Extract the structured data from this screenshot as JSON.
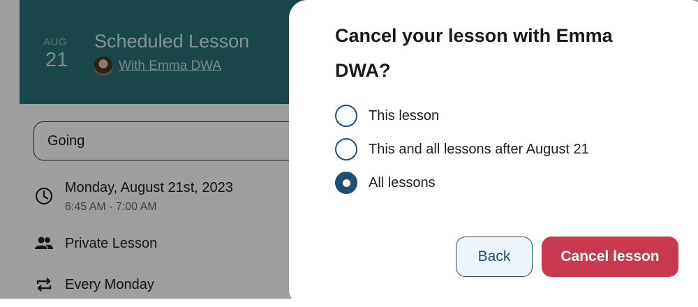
{
  "background": {
    "lesson": {
      "month": "AUG",
      "day": "21",
      "title": "Scheduled Lesson",
      "with_text": "With Emma DWA"
    },
    "rsvp": {
      "value": "Going"
    },
    "details": {
      "date": "Monday, August 21st, 2023",
      "time": "6:45 AM - 7:00 AM",
      "type": "Private Lesson",
      "recurrence": "Every Monday"
    },
    "icons": [
      "clock-icon",
      "people-icon",
      "repeat-icon"
    ]
  },
  "dialog": {
    "title": "Cancel your lesson with Emma DWA?",
    "options": [
      {
        "label": "This lesson",
        "selected": false
      },
      {
        "label": "This and all lessons after August 21",
        "selected": false
      },
      {
        "label": "All lessons",
        "selected": true
      }
    ],
    "back_label": "Back",
    "confirm_label": "Cancel lesson"
  },
  "colors": {
    "header_teal": "#2a7377",
    "primary_blue": "#1f4f73",
    "danger_red": "#c8384f"
  }
}
